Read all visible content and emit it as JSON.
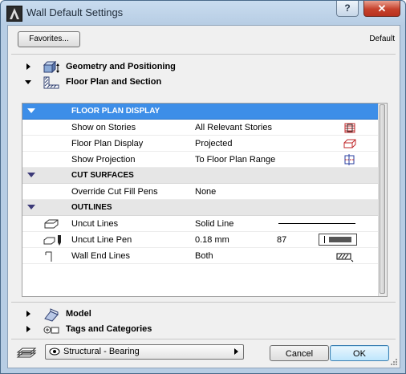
{
  "window": {
    "title": "Wall Default Settings",
    "help_label": "?",
    "close_label": "✕"
  },
  "toolbar": {
    "favorites_label": "Favorites...",
    "default_label": "Default"
  },
  "sections": {
    "geometry": {
      "label": "Geometry and Positioning",
      "icon": "wall-geometry-icon"
    },
    "floorplan": {
      "label": "Floor Plan and Section",
      "icon": "floor-plan-section-icon"
    },
    "model": {
      "label": "Model",
      "icon": "model-icon"
    },
    "tags": {
      "label": "Tags and Categories",
      "icon": "tags-categories-icon"
    }
  },
  "panel": {
    "floor_plan_display": {
      "header": "FLOOR PLAN DISPLAY",
      "rows": [
        {
          "label": "Show on Stories",
          "value": "All Relevant Stories",
          "icon": "stories-icon"
        },
        {
          "label": "Floor Plan Display",
          "value": "Projected",
          "icon": "projected-icon"
        },
        {
          "label": "Show Projection",
          "value": "To Floor Plan Range",
          "icon": "projection-range-icon"
        }
      ]
    },
    "cut_surfaces": {
      "header": "CUT SURFACES",
      "rows": [
        {
          "label": "Override Cut Fill Pens",
          "value": "None"
        }
      ]
    },
    "outlines": {
      "header": "OUTLINES",
      "rows": [
        {
          "label": "Uncut Lines",
          "value": "Solid Line",
          "icon": "uncut-lines-icon"
        },
        {
          "label": "Uncut Line Pen",
          "value": "0.18 mm",
          "extra": "87",
          "icon": "pen-icon"
        },
        {
          "label": "Wall End Lines",
          "value": "Both",
          "icon": "wall-end-icon"
        }
      ]
    }
  },
  "footer": {
    "layer_value": "Structural - Bearing",
    "cancel_label": "Cancel",
    "ok_label": "OK"
  },
  "colors": {
    "selection": "#3d8ee8",
    "header_bg": "#e6e6e6",
    "frame": "#b7cde4"
  }
}
